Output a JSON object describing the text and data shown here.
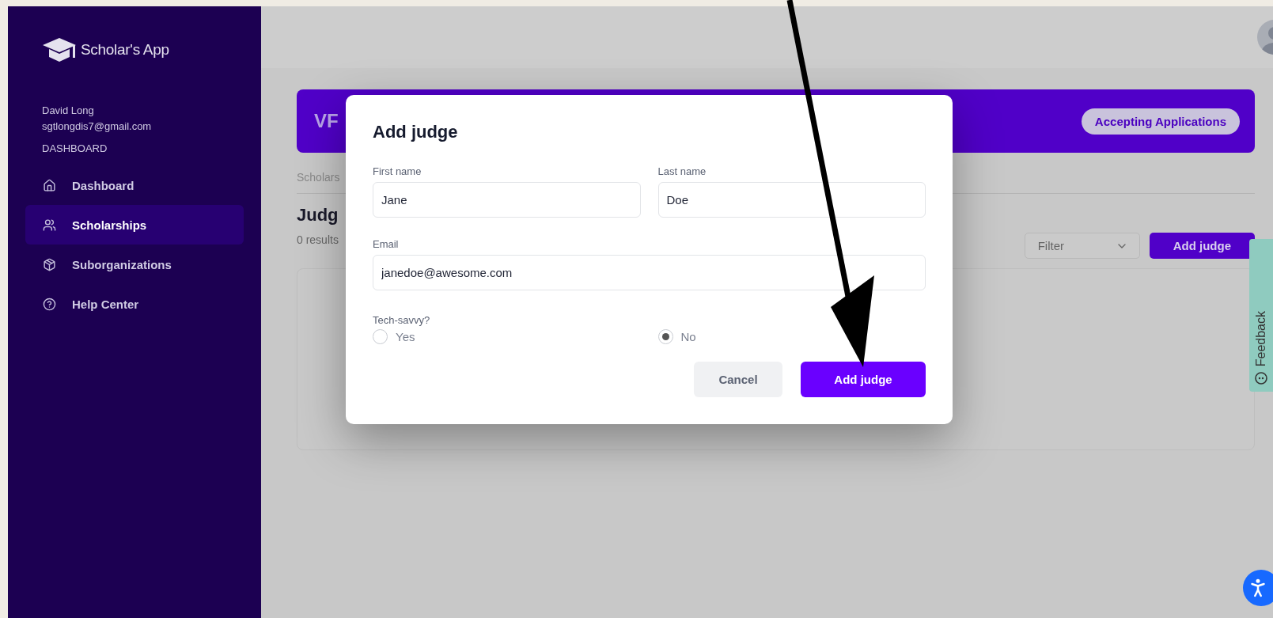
{
  "sidebar": {
    "logo": "Scholar's App",
    "user_name": "David Long",
    "user_email": "sgtlongdis7@gmail.com",
    "section": "DASHBOARD",
    "items": [
      {
        "label": "Dashboard",
        "selected": false
      },
      {
        "label": "Scholarships",
        "selected": true
      },
      {
        "label": "Suborganizations",
        "selected": false
      },
      {
        "label": "Help Center",
        "selected": false
      }
    ]
  },
  "banner": {
    "title": "VF",
    "status": "Accepting Applications"
  },
  "breadcrumb": "Scholars",
  "page_title": "Judg",
  "results": "0 results",
  "filter": {
    "label": "Filter"
  },
  "add_button": "Add judge",
  "feedback": "Feedback",
  "modal": {
    "title": "Add judge",
    "fields": [
      {
        "label": "First name",
        "value": "Jane"
      },
      {
        "label": "Last name",
        "value": "Doe"
      },
      {
        "label": "Email",
        "value": "janedoe@awesome.com"
      }
    ],
    "question": "Tech-savvy?",
    "options": [
      {
        "label": "Yes",
        "selected": false
      },
      {
        "label": "No",
        "selected": true
      }
    ],
    "buttons": [
      {
        "label": "Cancel",
        "kind": "secondary"
      },
      {
        "label": "Add judge",
        "kind": "primary"
      }
    ]
  }
}
